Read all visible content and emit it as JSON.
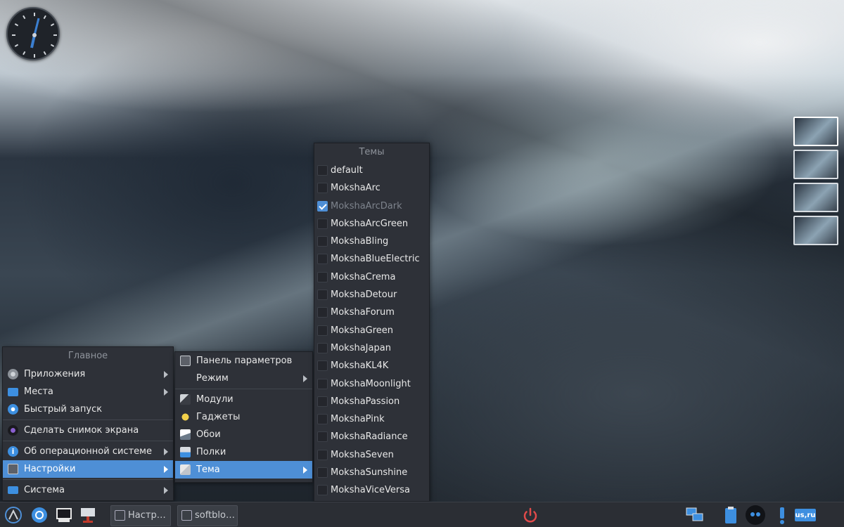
{
  "desktop": {
    "pager_count": 4,
    "active_desktop": 1
  },
  "main_menu": {
    "title": "Главное",
    "items": [
      {
        "label": "Приложения",
        "icon": "gear-icon",
        "submenu": true
      },
      {
        "label": "Места",
        "icon": "folder-icon",
        "submenu": true
      },
      {
        "label": "Быстрый запуск",
        "icon": "gear-icon",
        "submenu": false
      },
      {
        "label": "Сделать снимок экрана",
        "icon": "camera-icon",
        "submenu": false
      },
      {
        "label": "Об операционной системе",
        "icon": "info-icon",
        "submenu": true
      },
      {
        "label": "Настройки",
        "icon": "settings-icon",
        "submenu": true,
        "active": true
      },
      {
        "label": "Система",
        "icon": "monitor-icon",
        "submenu": true
      }
    ]
  },
  "settings_menu": {
    "items": [
      {
        "label": "Панель параметров",
        "icon": "settings-icon"
      },
      {
        "label": "Режим",
        "submenu": true
      },
      {
        "label": "Модули",
        "icon": "modules-icon"
      },
      {
        "label": "Гаджеты",
        "icon": "gadgets-icon"
      },
      {
        "label": "Обои",
        "icon": "wallpaper-icon"
      },
      {
        "label": "Полки",
        "icon": "shelves-icon"
      },
      {
        "label": "Тема",
        "icon": "theme-icon",
        "submenu": true,
        "active": true
      }
    ]
  },
  "theme_menu": {
    "title": "Темы",
    "selected": "MokshaArcDark",
    "items": [
      "default",
      "MokshaArc",
      "MokshaArcDark",
      "MokshaArcGreen",
      "MokshaBling",
      "MokshaBlueElectric",
      "MokshaCrema",
      "MokshaDetour",
      "MokshaForum",
      "MokshaGreen",
      "MokshaJapan",
      "MokshaKL4K",
      "MokshaMoonlight",
      "MokshaPassion",
      "MokshaPink",
      "MokshaRadiance",
      "MokshaSeven",
      "MokshaSunshine",
      "MokshaViceVersa"
    ]
  },
  "taskbar": {
    "launchers": [
      "menu-icon",
      "browser-icon",
      "terminal-icon",
      "installer-icon"
    ],
    "tasks": [
      {
        "label": "Настр…",
        "icon": "settings-icon"
      },
      {
        "label": "softblo…",
        "icon": "terminal-icon"
      }
    ],
    "tray": [
      "network-icon",
      "clipboard-icon",
      "media-icon",
      "notification-icon"
    ],
    "keyboard_layout": "us,ru",
    "colors": {
      "accent": "#4e8fd6",
      "power": "#e04a4a",
      "panel": "#2b2e34"
    }
  }
}
